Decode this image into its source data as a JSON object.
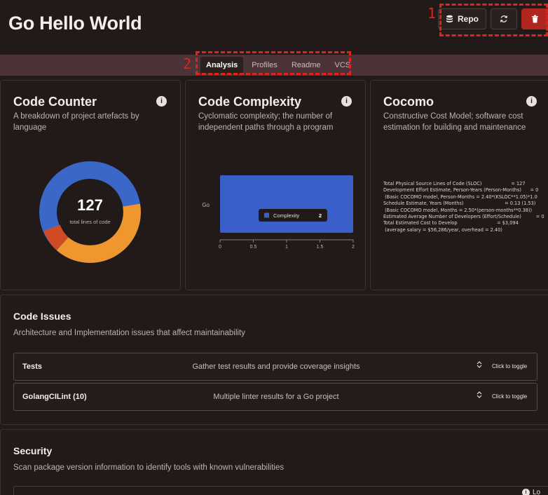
{
  "app": {
    "title": "Go Hello World"
  },
  "header": {
    "repo_label": "Repo"
  },
  "tabs": [
    "Analysis",
    "Profiles",
    "Readme",
    "VCS"
  ],
  "annotations": {
    "marker_1": "1",
    "marker_2": "2"
  },
  "code_counter": {
    "title": "Code Counter",
    "subtitle": "A breakdown of project artefacts by language",
    "total": "127",
    "total_label": "total lines of code",
    "colors": [
      "#3b67c9",
      "#f0962e",
      "#d04a26"
    ]
  },
  "code_complexity": {
    "title": "Code Complexity",
    "subtitle": "Cyclomatic complexity; the number of independent paths through a program",
    "chart_data": {
      "type": "bar",
      "orientation": "horizontal",
      "categories": [
        "Go"
      ],
      "series": [
        {
          "name": "Complexity",
          "values": [
            2
          ]
        }
      ],
      "xlim": [
        0,
        2
      ],
      "xticks": [
        "0",
        "0.5",
        "1",
        "1.5",
        "2"
      ],
      "tooltip": {
        "label": "Complexity",
        "value": "2"
      },
      "color": "#3b5fc9"
    }
  },
  "cocomo": {
    "title": "Cocomo",
    "subtitle": "Constructive Cost Model; software cost estimation for building and maintenance",
    "lines": [
      "Total Physical Source Lines of Code (SLOC)                    = 127",
      "Development Effort Estimate, Person-Years (Person-Months)      = 0",
      " (Basic COCOMO model, Person-Months = 2.40*(KSLOC**1.05)*1.0",
      "Schedule Estimate, Years (Months)                            = 0.13 (1.53)",
      " (Basic COCOMO model, Months = 2.50*(person-months**0.38))",
      "Estimated Average Number of Developers (Effort/Schedule)          = 0",
      "Total Estimated Cost to Develop                           = $3,094",
      " (average salary = $56,286/year, overhead = 2.40)"
    ]
  },
  "code_issues": {
    "title": "Code Issues",
    "subtitle": "Architecture and Implementation issues that affect maintainability",
    "items": [
      {
        "name": "Tests",
        "description": "Gather test results and provide coverage insights",
        "toggle": "Click to toggle"
      },
      {
        "name": "GolangCILint (10)",
        "description": "Multiple linter results for a Go project",
        "toggle": "Click to toggle"
      }
    ]
  },
  "security": {
    "title": "Security",
    "subtitle": "Scan package version information to identify tools with known vulnerabilities",
    "partial_label": "Lo"
  }
}
